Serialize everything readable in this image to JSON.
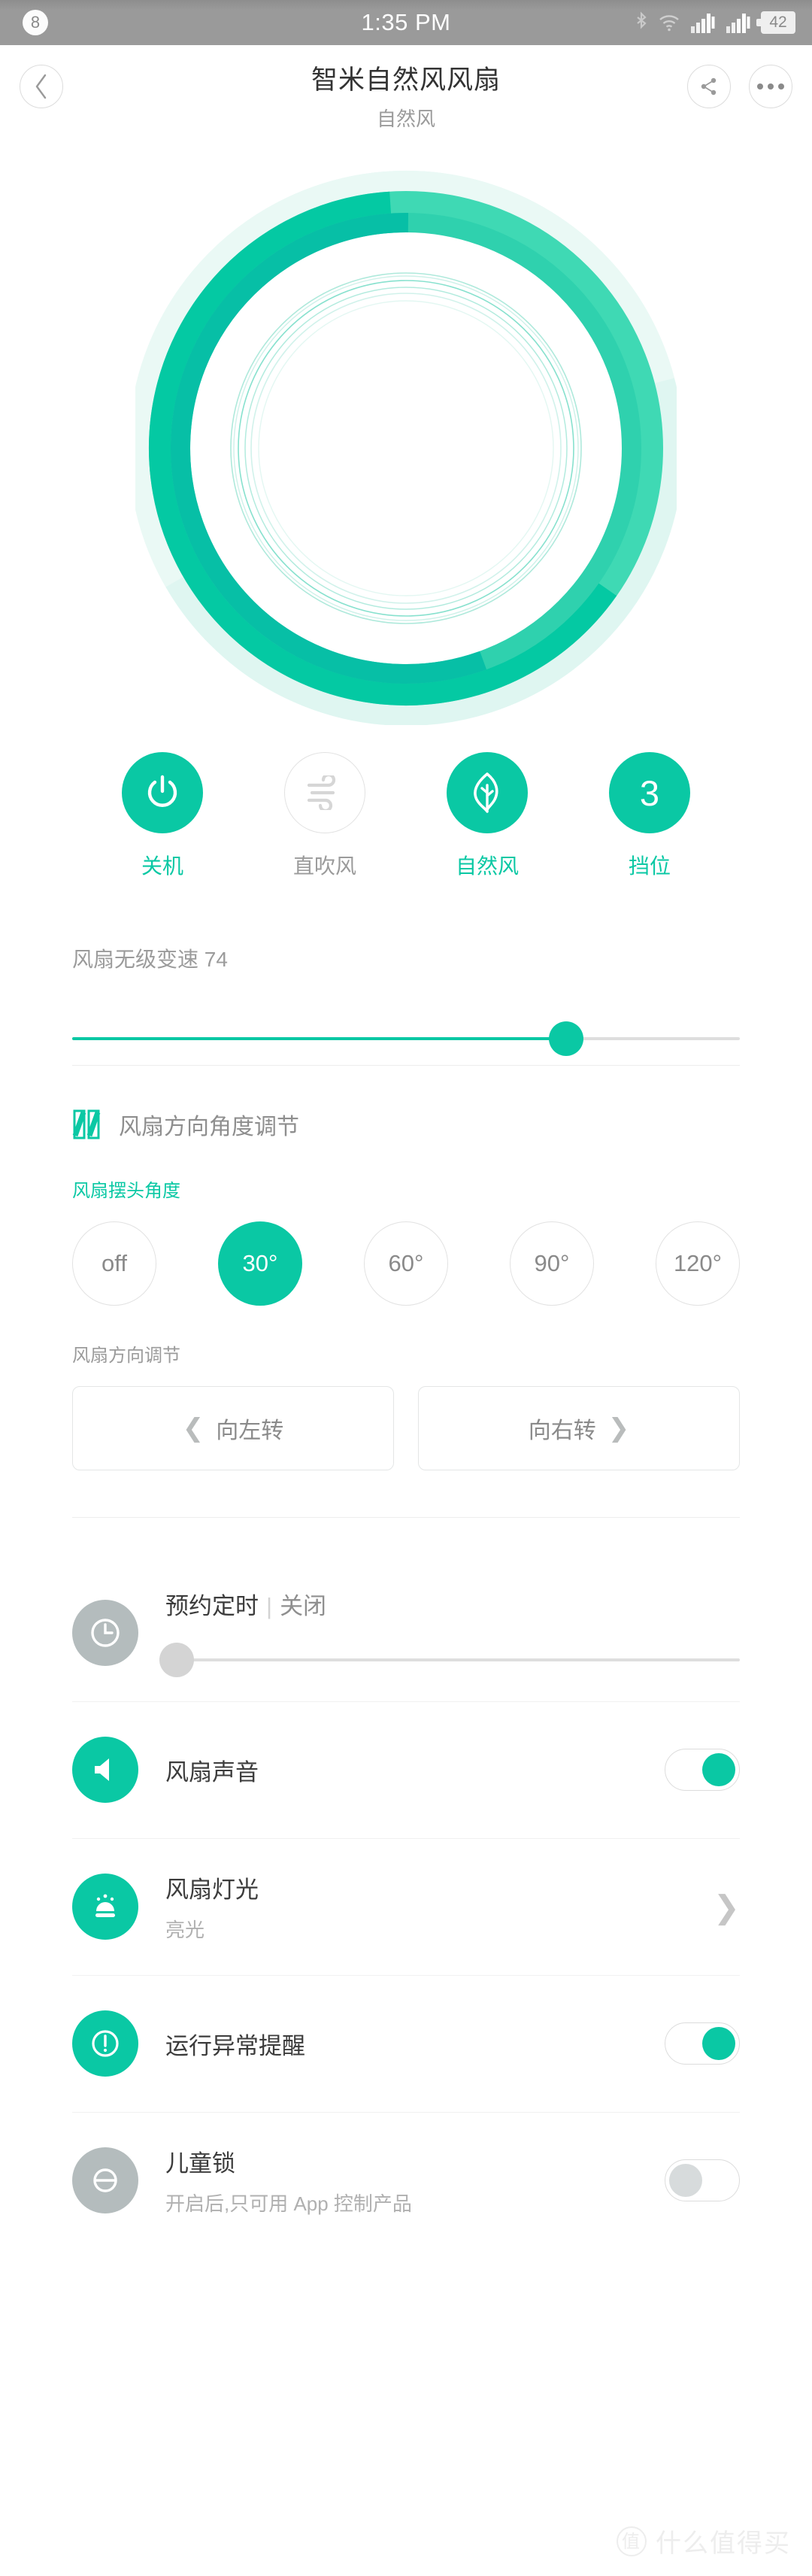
{
  "status_bar": {
    "notification_count": "8",
    "time": "1:35 PM",
    "battery_percent": "42",
    "icons": [
      "bluetooth-icon",
      "wifi-icon",
      "signal-1-icon",
      "signal-2-icon",
      "battery-icon"
    ]
  },
  "header": {
    "title": "智米自然风风扇",
    "subtitle": "自然风",
    "back_icon": "chevron-left-icon",
    "share_icon": "share-icon",
    "more_icon": "more-icon"
  },
  "fan_visual": {
    "name": "fan-ring-graphic",
    "colors": {
      "halo": "#d9f5ef",
      "ring_light": "#3fd9b4",
      "ring_core": "#05c7a2",
      "ring_dark": "#06bfa8",
      "inner_line": "#8fdfcf"
    }
  },
  "actions": [
    {
      "label": "关机",
      "icon": "power-icon",
      "active": true
    },
    {
      "label": "直吹风",
      "icon": "wind-icon",
      "active": false
    },
    {
      "label": "自然风",
      "icon": "leaf-icon",
      "active": true
    },
    {
      "label": "挡位",
      "icon": "gear-level-icon",
      "value": "3",
      "active": true
    }
  ],
  "speed": {
    "label": "风扇无级变速 74",
    "value": 74,
    "percent": "74%"
  },
  "direction_section": {
    "icon": "angle-adjust-icon",
    "title": "风扇方向角度调节",
    "swing_label": "风扇摆头角度",
    "angles": [
      {
        "label": "off",
        "selected": false
      },
      {
        "label": "30°",
        "selected": true
      },
      {
        "label": "60°",
        "selected": false
      },
      {
        "label": "90°",
        "selected": false
      },
      {
        "label": "120°",
        "selected": false
      }
    ],
    "direction_label": "风扇方向调节",
    "turn_left": "向左转",
    "turn_right": "向右转",
    "left_icon": "chevron-left-icon",
    "right_icon": "chevron-right-icon"
  },
  "rows": {
    "timer": {
      "icon": "clock-icon",
      "title": "预约定时",
      "separator": "|",
      "state": "关闭",
      "value": 0
    },
    "sound": {
      "icon": "speaker-icon",
      "title": "风扇声音",
      "toggle": "on"
    },
    "light": {
      "icon": "lamp-icon",
      "title": "风扇灯光",
      "subtitle": "亮光",
      "chevron": "chevron-right-icon"
    },
    "alert": {
      "icon": "alert-icon",
      "title": "运行异常提醒",
      "toggle": "on"
    },
    "childlock": {
      "icon": "lock-icon",
      "title": "儿童锁",
      "subtitle": "开启后,只可用 App 控制产品",
      "toggle": "off"
    }
  },
  "watermark": {
    "logo": "值",
    "text": "什么值得买"
  },
  "theme": {
    "accent": "#0ac8a4",
    "text_primary": "#3c3c3c",
    "text_muted": "#9b9b9b"
  }
}
